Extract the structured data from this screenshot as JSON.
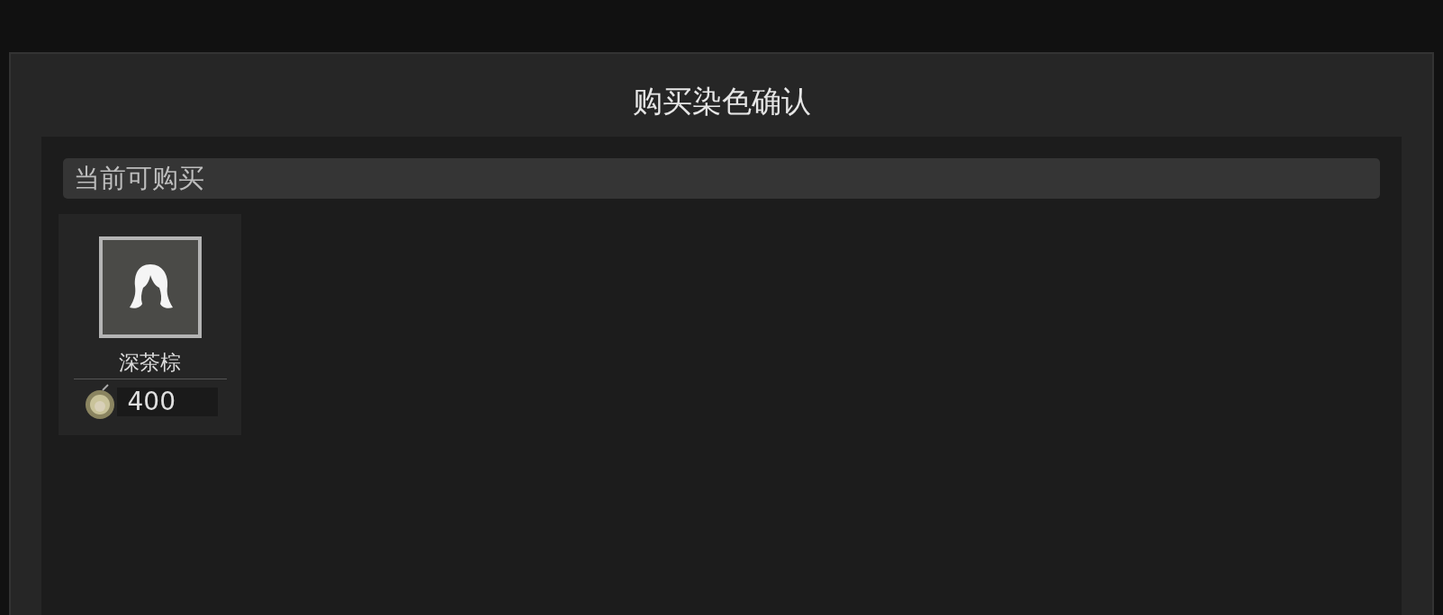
{
  "dialog": {
    "title": "购买染色确认"
  },
  "section": {
    "title": "当前可购买"
  },
  "items": [
    {
      "name": "深茶棕",
      "price": "400"
    }
  ]
}
